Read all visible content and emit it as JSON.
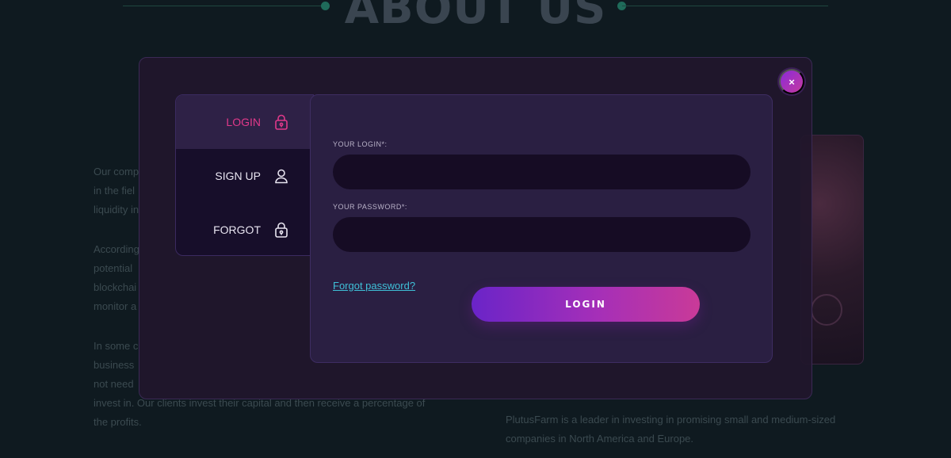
{
  "background": {
    "title": "ABOUT US",
    "left_paragraphs": [
      "Our comp",
      "in the fiel",
      "liquidity in",
      "According",
      "potential",
      "blockchai",
      "monitor a",
      "In some c",
      "business",
      "not need",
      "invest in. Our clients invest their capital and then receive a percentage of",
      "the profits."
    ],
    "right_paragraph_lines": [
      "PlutusFarm is a leader in investing in promising small and medium-sized",
      "companies in North America and Europe."
    ]
  },
  "modal": {
    "close_label": "×",
    "tabs": [
      {
        "label": "LOGIN",
        "icon": "lock-icon",
        "active": true
      },
      {
        "label": "SIGN UP",
        "icon": "user-icon",
        "active": false
      },
      {
        "label": "FORGOT",
        "icon": "lock-icon",
        "active": false
      }
    ],
    "login_label": "YOUR LOGIN*:",
    "login_value": "",
    "password_label": "YOUR PASSWORD*:",
    "password_value": "",
    "forgot_link": "Forgot password?",
    "submit_label": "LOGIN"
  },
  "colors": {
    "accent_pink": "#e0398a",
    "accent_purple": "#6a24c8",
    "link_cyan": "#3fc0d8",
    "panel": "#2a1f42"
  }
}
